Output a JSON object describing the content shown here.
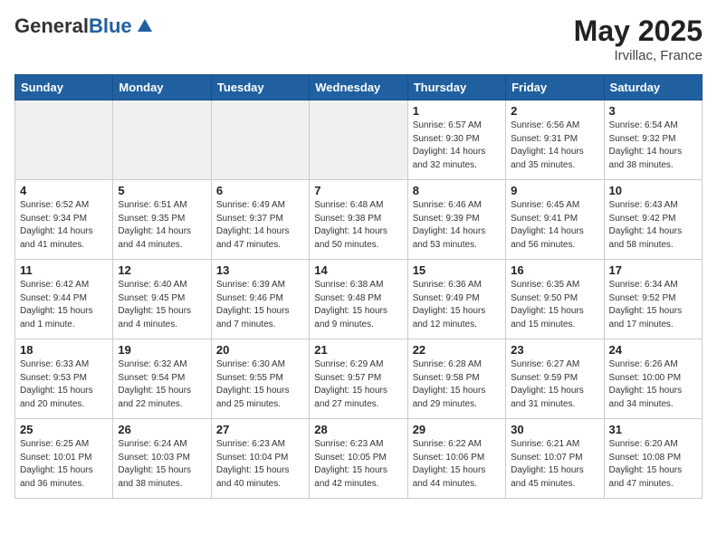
{
  "header": {
    "logo_general": "General",
    "logo_blue": "Blue",
    "month": "May 2025",
    "location": "Irvillac, France"
  },
  "weekdays": [
    "Sunday",
    "Monday",
    "Tuesday",
    "Wednesday",
    "Thursday",
    "Friday",
    "Saturday"
  ],
  "weeks": [
    [
      {
        "day": "",
        "info": "",
        "shaded": true
      },
      {
        "day": "",
        "info": "",
        "shaded": true
      },
      {
        "day": "",
        "info": "",
        "shaded": true
      },
      {
        "day": "",
        "info": "",
        "shaded": true
      },
      {
        "day": "1",
        "info": "Sunrise: 6:57 AM\nSunset: 9:30 PM\nDaylight: 14 hours\nand 32 minutes."
      },
      {
        "day": "2",
        "info": "Sunrise: 6:56 AM\nSunset: 9:31 PM\nDaylight: 14 hours\nand 35 minutes."
      },
      {
        "day": "3",
        "info": "Sunrise: 6:54 AM\nSunset: 9:32 PM\nDaylight: 14 hours\nand 38 minutes."
      }
    ],
    [
      {
        "day": "4",
        "info": "Sunrise: 6:52 AM\nSunset: 9:34 PM\nDaylight: 14 hours\nand 41 minutes."
      },
      {
        "day": "5",
        "info": "Sunrise: 6:51 AM\nSunset: 9:35 PM\nDaylight: 14 hours\nand 44 minutes."
      },
      {
        "day": "6",
        "info": "Sunrise: 6:49 AM\nSunset: 9:37 PM\nDaylight: 14 hours\nand 47 minutes."
      },
      {
        "day": "7",
        "info": "Sunrise: 6:48 AM\nSunset: 9:38 PM\nDaylight: 14 hours\nand 50 minutes."
      },
      {
        "day": "8",
        "info": "Sunrise: 6:46 AM\nSunset: 9:39 PM\nDaylight: 14 hours\nand 53 minutes."
      },
      {
        "day": "9",
        "info": "Sunrise: 6:45 AM\nSunset: 9:41 PM\nDaylight: 14 hours\nand 56 minutes."
      },
      {
        "day": "10",
        "info": "Sunrise: 6:43 AM\nSunset: 9:42 PM\nDaylight: 14 hours\nand 58 minutes."
      }
    ],
    [
      {
        "day": "11",
        "info": "Sunrise: 6:42 AM\nSunset: 9:44 PM\nDaylight: 15 hours\nand 1 minute."
      },
      {
        "day": "12",
        "info": "Sunrise: 6:40 AM\nSunset: 9:45 PM\nDaylight: 15 hours\nand 4 minutes."
      },
      {
        "day": "13",
        "info": "Sunrise: 6:39 AM\nSunset: 9:46 PM\nDaylight: 15 hours\nand 7 minutes."
      },
      {
        "day": "14",
        "info": "Sunrise: 6:38 AM\nSunset: 9:48 PM\nDaylight: 15 hours\nand 9 minutes."
      },
      {
        "day": "15",
        "info": "Sunrise: 6:36 AM\nSunset: 9:49 PM\nDaylight: 15 hours\nand 12 minutes."
      },
      {
        "day": "16",
        "info": "Sunrise: 6:35 AM\nSunset: 9:50 PM\nDaylight: 15 hours\nand 15 minutes."
      },
      {
        "day": "17",
        "info": "Sunrise: 6:34 AM\nSunset: 9:52 PM\nDaylight: 15 hours\nand 17 minutes."
      }
    ],
    [
      {
        "day": "18",
        "info": "Sunrise: 6:33 AM\nSunset: 9:53 PM\nDaylight: 15 hours\nand 20 minutes."
      },
      {
        "day": "19",
        "info": "Sunrise: 6:32 AM\nSunset: 9:54 PM\nDaylight: 15 hours\nand 22 minutes."
      },
      {
        "day": "20",
        "info": "Sunrise: 6:30 AM\nSunset: 9:55 PM\nDaylight: 15 hours\nand 25 minutes."
      },
      {
        "day": "21",
        "info": "Sunrise: 6:29 AM\nSunset: 9:57 PM\nDaylight: 15 hours\nand 27 minutes."
      },
      {
        "day": "22",
        "info": "Sunrise: 6:28 AM\nSunset: 9:58 PM\nDaylight: 15 hours\nand 29 minutes."
      },
      {
        "day": "23",
        "info": "Sunrise: 6:27 AM\nSunset: 9:59 PM\nDaylight: 15 hours\nand 31 minutes."
      },
      {
        "day": "24",
        "info": "Sunrise: 6:26 AM\nSunset: 10:00 PM\nDaylight: 15 hours\nand 34 minutes."
      }
    ],
    [
      {
        "day": "25",
        "info": "Sunrise: 6:25 AM\nSunset: 10:01 PM\nDaylight: 15 hours\nand 36 minutes."
      },
      {
        "day": "26",
        "info": "Sunrise: 6:24 AM\nSunset: 10:03 PM\nDaylight: 15 hours\nand 38 minutes."
      },
      {
        "day": "27",
        "info": "Sunrise: 6:23 AM\nSunset: 10:04 PM\nDaylight: 15 hours\nand 40 minutes."
      },
      {
        "day": "28",
        "info": "Sunrise: 6:23 AM\nSunset: 10:05 PM\nDaylight: 15 hours\nand 42 minutes."
      },
      {
        "day": "29",
        "info": "Sunrise: 6:22 AM\nSunset: 10:06 PM\nDaylight: 15 hours\nand 44 minutes."
      },
      {
        "day": "30",
        "info": "Sunrise: 6:21 AM\nSunset: 10:07 PM\nDaylight: 15 hours\nand 45 minutes."
      },
      {
        "day": "31",
        "info": "Sunrise: 6:20 AM\nSunset: 10:08 PM\nDaylight: 15 hours\nand 47 minutes."
      }
    ]
  ]
}
